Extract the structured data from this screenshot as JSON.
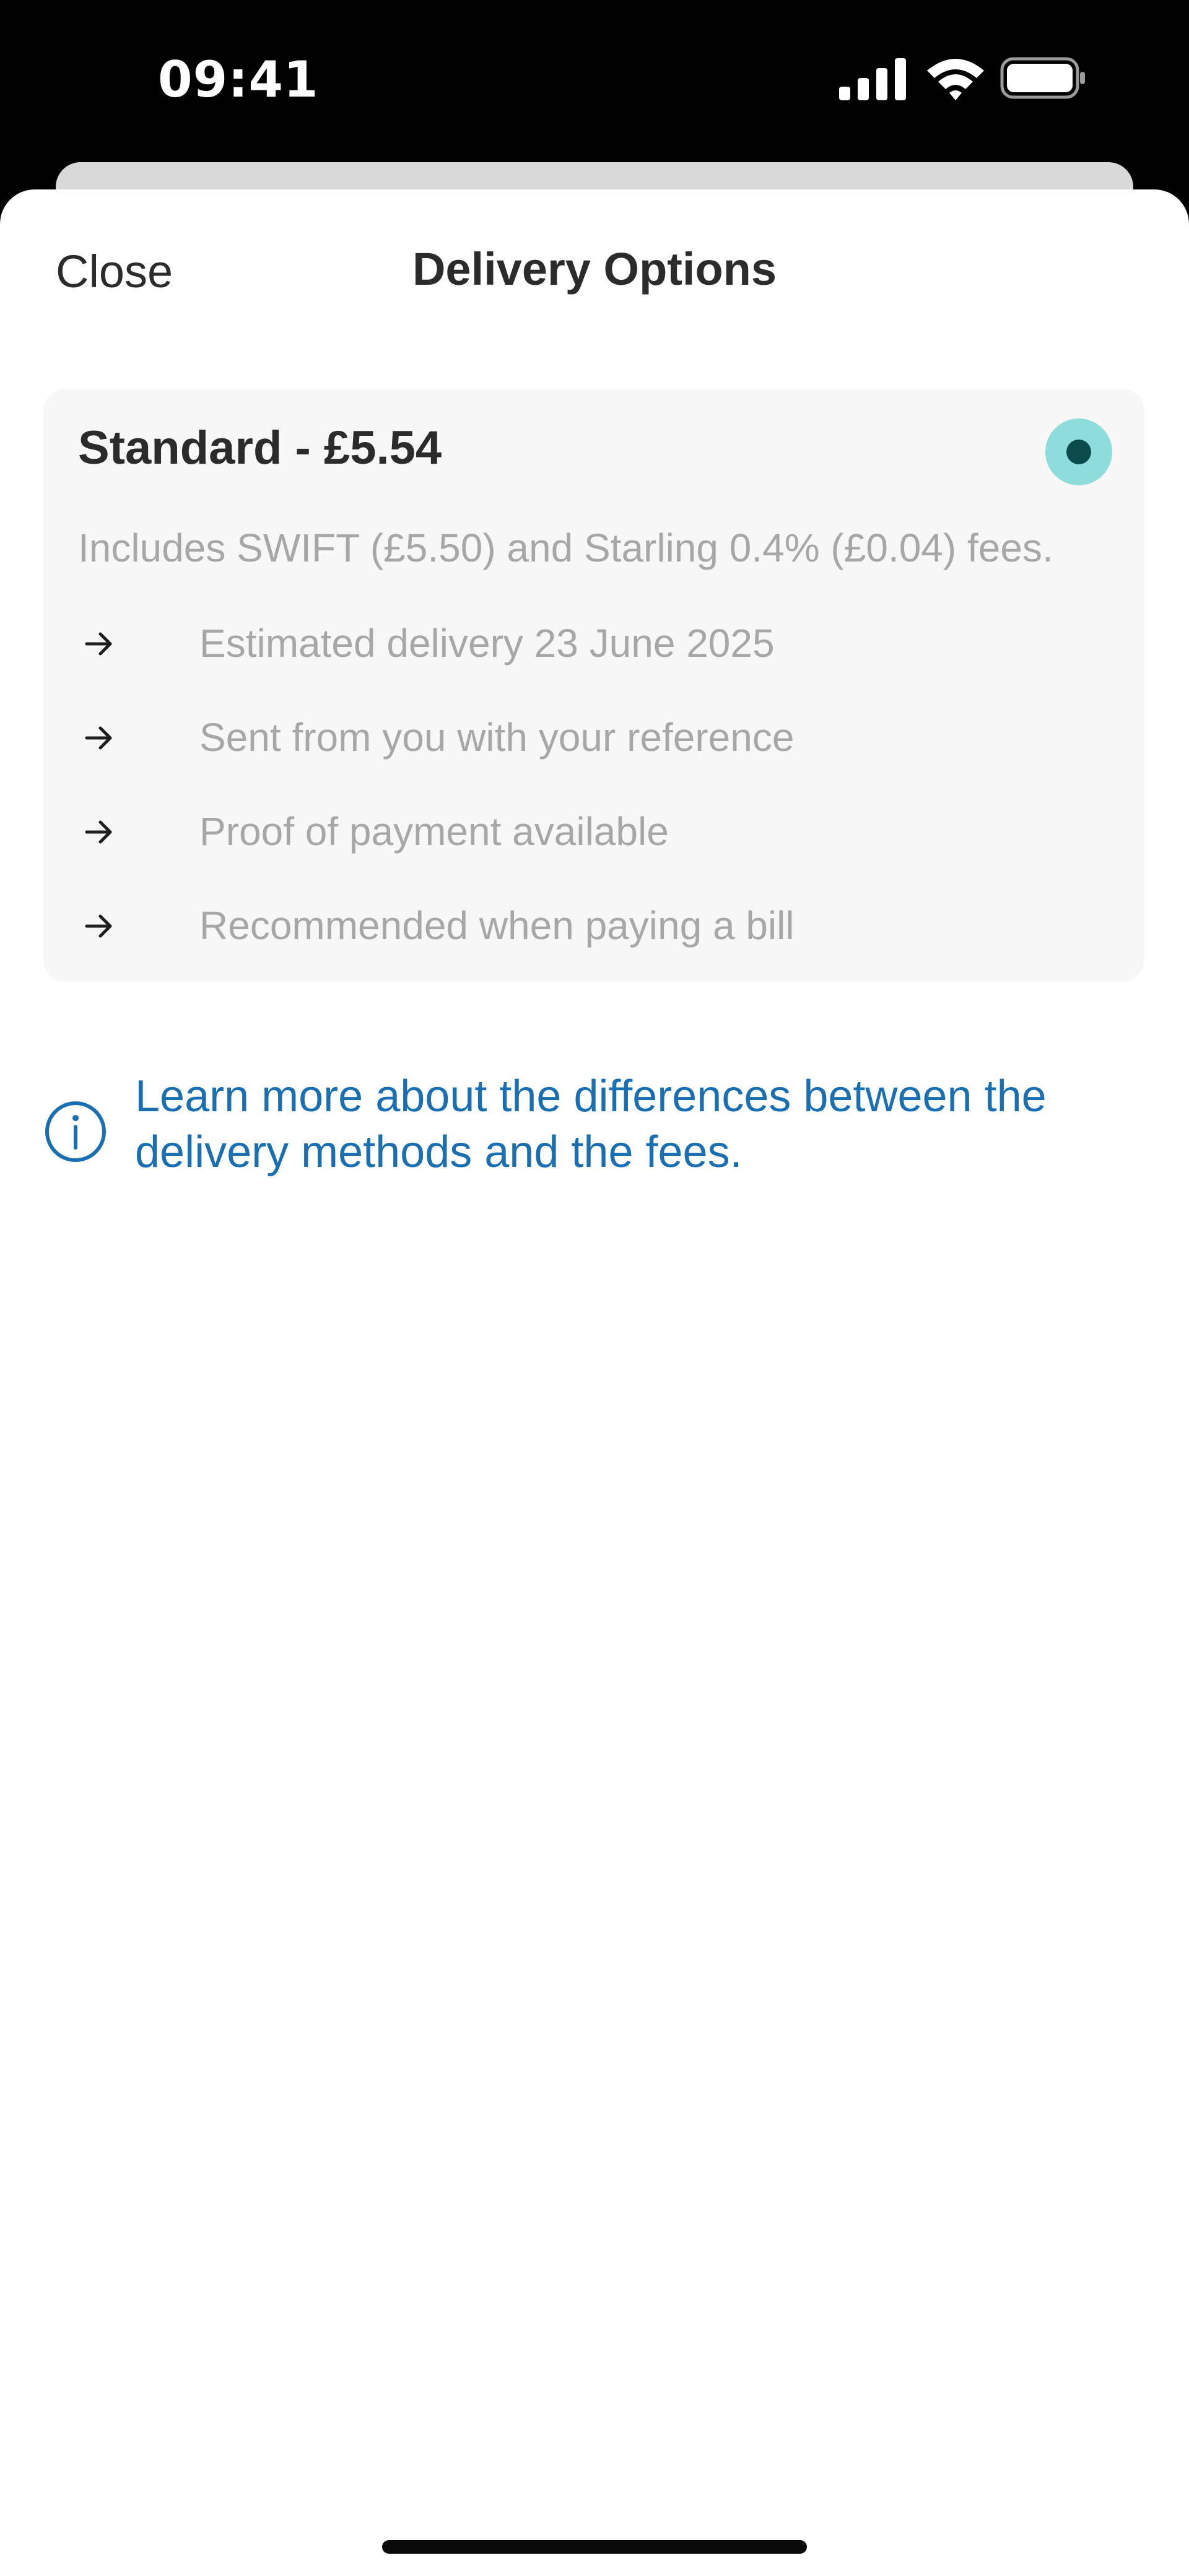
{
  "status_bar": {
    "time": "09:41",
    "icons": [
      "cellular-signal-icon",
      "wifi-icon",
      "battery-icon"
    ]
  },
  "sheet": {
    "close_label": "Close",
    "title": "Delivery Options"
  },
  "option": {
    "title": "Standard - £5.54",
    "selected": true,
    "description": "Includes SWIFT (£5.50) and Starling 0.4% (£0.04) fees.",
    "features": [
      "Estimated delivery 23 June 2025",
      "Sent from you with your reference",
      "Proof of payment available",
      "Recommended when paying a bill"
    ]
  },
  "info": {
    "link_text": "Learn more about the differences between the delivery methods and the fees."
  },
  "colors": {
    "radio_outer": "#8fdcdc",
    "radio_inner": "#0c4b4d",
    "link": "#1a6fb3",
    "muted_text": "#a7a7a7",
    "card_bg": "#f7f7f7"
  }
}
